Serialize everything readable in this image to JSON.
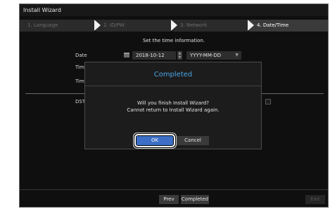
{
  "window": {
    "title": "Install Wizard"
  },
  "steps": [
    {
      "label": "1. Language",
      "active": false
    },
    {
      "label": "2. ID/PW",
      "active": false
    },
    {
      "label": "3. Network",
      "active": false
    },
    {
      "label": "4. Date/Time",
      "active": true
    }
  ],
  "main": {
    "instruction": "Set the time information.",
    "date_label": "Date",
    "date_value": "2018-10-12",
    "date_format": "YYYY-MM-DD",
    "time_label_1": "Tim",
    "time_label_2": "Tim",
    "dst_label": "DST"
  },
  "footer": {
    "prev_label": "Prev",
    "completed_label": "Completed",
    "exit_label": "Exit"
  },
  "dialog": {
    "title": "Completed",
    "message_line1": "Will you finish Install Wizard?",
    "message_line2": "Cannot return to Install Wizard again.",
    "ok_label": "OK",
    "cancel_label": "Cancel"
  },
  "colors": {
    "accent": "#4aa6e8",
    "ok_button": "#3d6fc6",
    "background": "#0f0f0f"
  }
}
